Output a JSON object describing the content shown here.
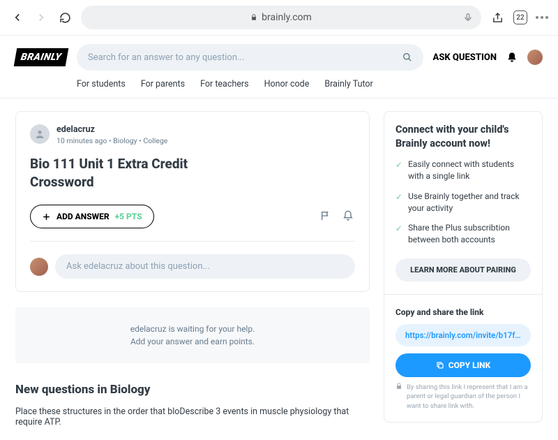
{
  "browser": {
    "url_host": "brainly.com",
    "tab_count": "22"
  },
  "header": {
    "logo": "BRAINLY",
    "search_placeholder": "Search for an answer to any question...",
    "ask": "ASK QUESTION"
  },
  "nav": {
    "students": "For students",
    "parents": "For parents",
    "teachers": "For teachers",
    "honor": "Honor code",
    "tutor": "Brainly Tutor"
  },
  "question": {
    "user": "edelacruz",
    "meta": "10 minutes ago  •  Biology  •  College",
    "title": "Bio 111 Unit 1 Extra Credit Crossword",
    "add_answer": "ADD ANSWER",
    "pts": "+5 PTS",
    "ask_placeholder": "Ask edelacruz about this question...",
    "waiting_line1": "edelacruz is waiting for your help.",
    "waiting_line2": "Add your answer and earn points."
  },
  "newq": {
    "title": "New questions in Biology",
    "item1": "Place these structures in the order that bloDescribe 3 events in muscle physiology that require ATP."
  },
  "sidebar": {
    "title": "Connect with your child's Brainly account now!",
    "b1": "Easily connect with students with a single link",
    "b2": "Use Brainly together and track your activity",
    "b3": "Share the Plus subscribtion between both accounts",
    "learn": "LEARN MORE ABOUT PAIRING",
    "copy_title": "Copy and share the link",
    "link": "https://brainly.com/invite/b17ff..",
    "copy_btn": "COPY LINK",
    "disclaimer": "By sharing this link I represent that I am a parent or legal guardian of the person I want to share link with."
  }
}
